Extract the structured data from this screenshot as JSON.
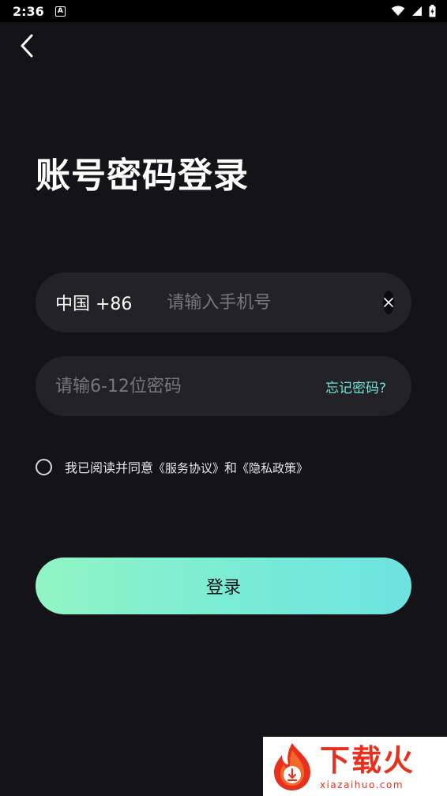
{
  "status_bar": {
    "time": "2:36",
    "notif_glyph": "A"
  },
  "header": {
    "title": "账号密码登录"
  },
  "phone_field": {
    "country_code": "中国 +86",
    "placeholder": "请输入手机号",
    "value": ""
  },
  "password_field": {
    "placeholder": "请输6-12位密码",
    "value": "",
    "forgot_label": "忘记密码?"
  },
  "agreement": {
    "prefix": "我已阅读并同意",
    "service_link": "《服务协议》",
    "conjunction": "和",
    "privacy_link": "《隐私政策》",
    "checked": false
  },
  "login_button": {
    "label": "登录"
  },
  "watermark": {
    "brand": "下载火",
    "url": "xiazaihuo.com"
  },
  "colors": {
    "background": "#141418",
    "field": "#232327",
    "accent": "#6fe3d8",
    "button_start": "#92f5c4",
    "button_end": "#6ee2e0",
    "watermark_red": "#e8301e"
  },
  "icons": {
    "back": "chevron-left-icon",
    "clear": "close-icon",
    "wifi": "wifi-icon",
    "signal": "signal-icon",
    "battery": "battery-icon"
  }
}
